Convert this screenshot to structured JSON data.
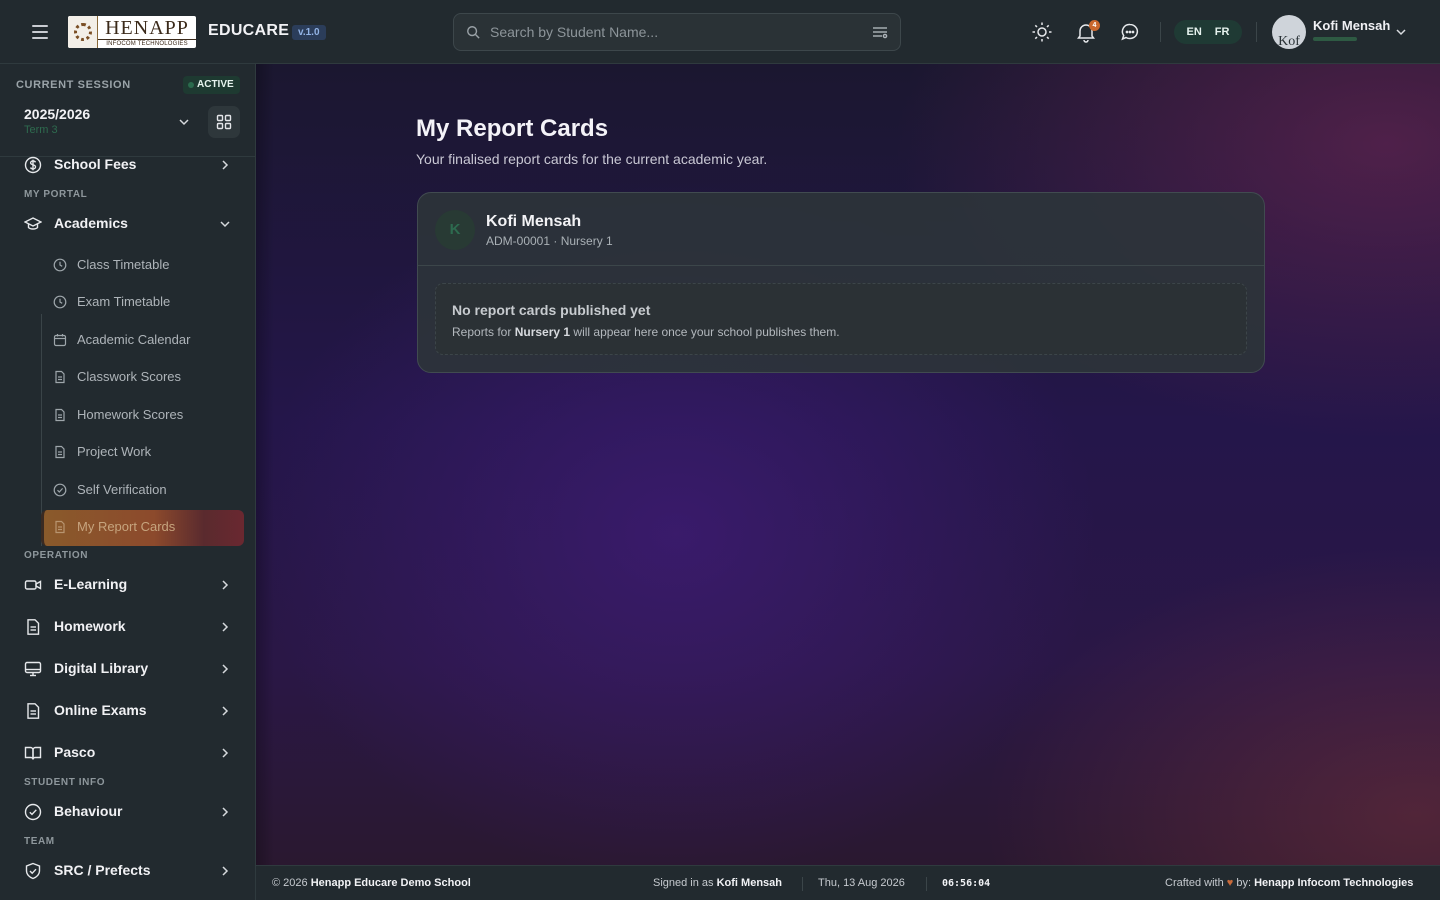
{
  "app": {
    "logo_big": "HENAPP",
    "logo_small": "INFOCOM TECHNOLOGIES",
    "name": "EDUCARE",
    "version": "v.1.0"
  },
  "search": {
    "placeholder": "Search by Student Name..."
  },
  "header": {
    "notifications_count": "4",
    "lang_en": "EN",
    "lang_fr": "FR",
    "user_name": "Kofi Mensah",
    "avatar_text": "Kof"
  },
  "session": {
    "label": "CURRENT SESSION",
    "badge": "ACTIVE",
    "year": "2025/2026",
    "term": "Term 3"
  },
  "sidebar": {
    "school_fees": "School Fees",
    "section_portal": "MY PORTAL",
    "academics": "Academics",
    "sub": [
      "Class Timetable",
      "Exam Timetable",
      "Academic Calendar",
      "Classwork Scores",
      "Homework Scores",
      "Project Work",
      "Self Verification",
      "My Report Cards"
    ],
    "section_operation": "OPERATION",
    "e_learning": "E-Learning",
    "homework": "Homework",
    "digital_library": "Digital Library",
    "online_exams": "Online Exams",
    "pasco": "Pasco",
    "section_student_info": "STUDENT INFO",
    "behaviour": "Behaviour",
    "section_team": "TEAM",
    "src_prefects": "SRC / Prefects"
  },
  "main": {
    "title": "My Report Cards",
    "subtitle": "Your finalised report cards for the current academic year.",
    "student": {
      "initial": "K",
      "name": "Kofi Mensah",
      "meta": "ADM-00001 · Nursery 1"
    },
    "empty": {
      "title": "No report cards published yet",
      "desc_prefix": "Reports for ",
      "desc_class": "Nursery 1",
      "desc_suffix": " will appear here once your school publishes them."
    }
  },
  "footer": {
    "copyright_prefix": "© 2026 ",
    "school": "Henapp Educare Demo School",
    "signed_prefix": "Signed in as ",
    "signed_user": "Kofi Mensah",
    "date": "Thu, 13 Aug 2026",
    "time": "06:56:04",
    "crafted_prefix": "Crafted with ",
    "heart": "♥",
    "crafted_mid": " by: ",
    "company": "Henapp Infocom Technologies"
  },
  "colors": {
    "accent_active": "#8a5a2b",
    "status_green": "#2a6b4d",
    "badge_orange": "#c9672d"
  }
}
